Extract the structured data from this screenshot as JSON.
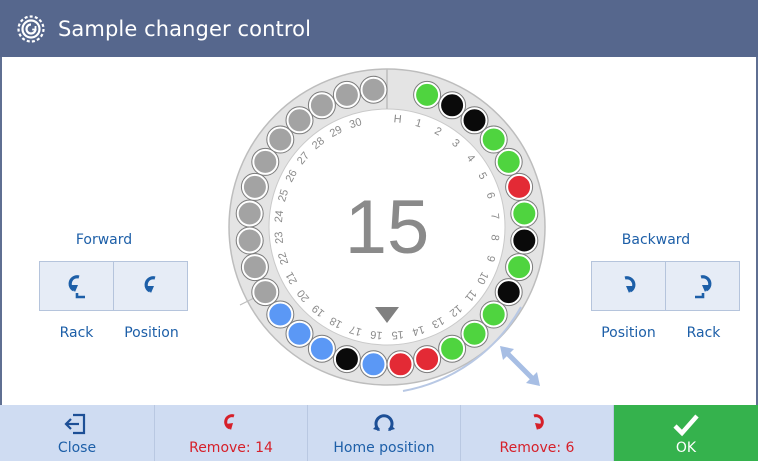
{
  "window": {
    "title": "Sample changer control",
    "icon": "changer-gear-icon"
  },
  "forward": {
    "heading": "Forward",
    "rack_label": "Rack",
    "position_label": "Position",
    "rack_icon": "rotate-ccw-rack-icon",
    "position_icon": "rotate-ccw-icon"
  },
  "backward": {
    "heading": "Backward",
    "position_label": "Position",
    "rack_label": "Rack",
    "position_icon": "rotate-cw-icon",
    "rack_icon": "rotate-cw-rack-icon"
  },
  "carousel": {
    "current_position": "15",
    "home_label": "H",
    "positions": [
      {
        "label": "H",
        "state": "empty"
      },
      {
        "label": "1",
        "state": "green"
      },
      {
        "label": "2",
        "state": "black"
      },
      {
        "label": "3",
        "state": "black"
      },
      {
        "label": "4",
        "state": "green"
      },
      {
        "label": "5",
        "state": "green"
      },
      {
        "label": "6",
        "state": "red"
      },
      {
        "label": "7",
        "state": "green"
      },
      {
        "label": "8",
        "state": "black"
      },
      {
        "label": "9",
        "state": "green"
      },
      {
        "label": "10",
        "state": "black"
      },
      {
        "label": "11",
        "state": "green"
      },
      {
        "label": "12",
        "state": "green"
      },
      {
        "label": "13",
        "state": "green"
      },
      {
        "label": "14",
        "state": "red"
      },
      {
        "label": "15",
        "state": "red"
      },
      {
        "label": "16",
        "state": "blue"
      },
      {
        "label": "17",
        "state": "black"
      },
      {
        "label": "18",
        "state": "blue"
      },
      {
        "label": "19",
        "state": "blue"
      },
      {
        "label": "20",
        "state": "blue"
      },
      {
        "label": "21",
        "state": "grey"
      },
      {
        "label": "22",
        "state": "grey"
      },
      {
        "label": "23",
        "state": "grey"
      },
      {
        "label": "24",
        "state": "grey"
      },
      {
        "label": "25",
        "state": "grey"
      },
      {
        "label": "26",
        "state": "grey"
      },
      {
        "label": "27",
        "state": "grey"
      },
      {
        "label": "28",
        "state": "grey"
      },
      {
        "label": "29",
        "state": "grey"
      },
      {
        "label": "30",
        "state": "grey"
      },
      {
        "label": "H",
        "state": "grey"
      }
    ],
    "colors": {
      "green": "#4fd43f",
      "black": "#0a0a0a",
      "red": "#e32a35",
      "blue": "#5b98f5",
      "grey": "#a3a3a3",
      "ring": "#dcdcdc",
      "number": "#8a8a8a"
    }
  },
  "toolbar": {
    "close_label": "Close",
    "remove14_label": "Remove: 14",
    "home_label": "Home position",
    "remove6_label": "Remove: 6",
    "ok_label": "OK"
  },
  "colors": {
    "titlebar": "#56678d",
    "toolbar": "#cfdcf2",
    "ok": "#35b24d",
    "accent_blue": "#1d5fa8",
    "remove_red": "#d6202a"
  }
}
